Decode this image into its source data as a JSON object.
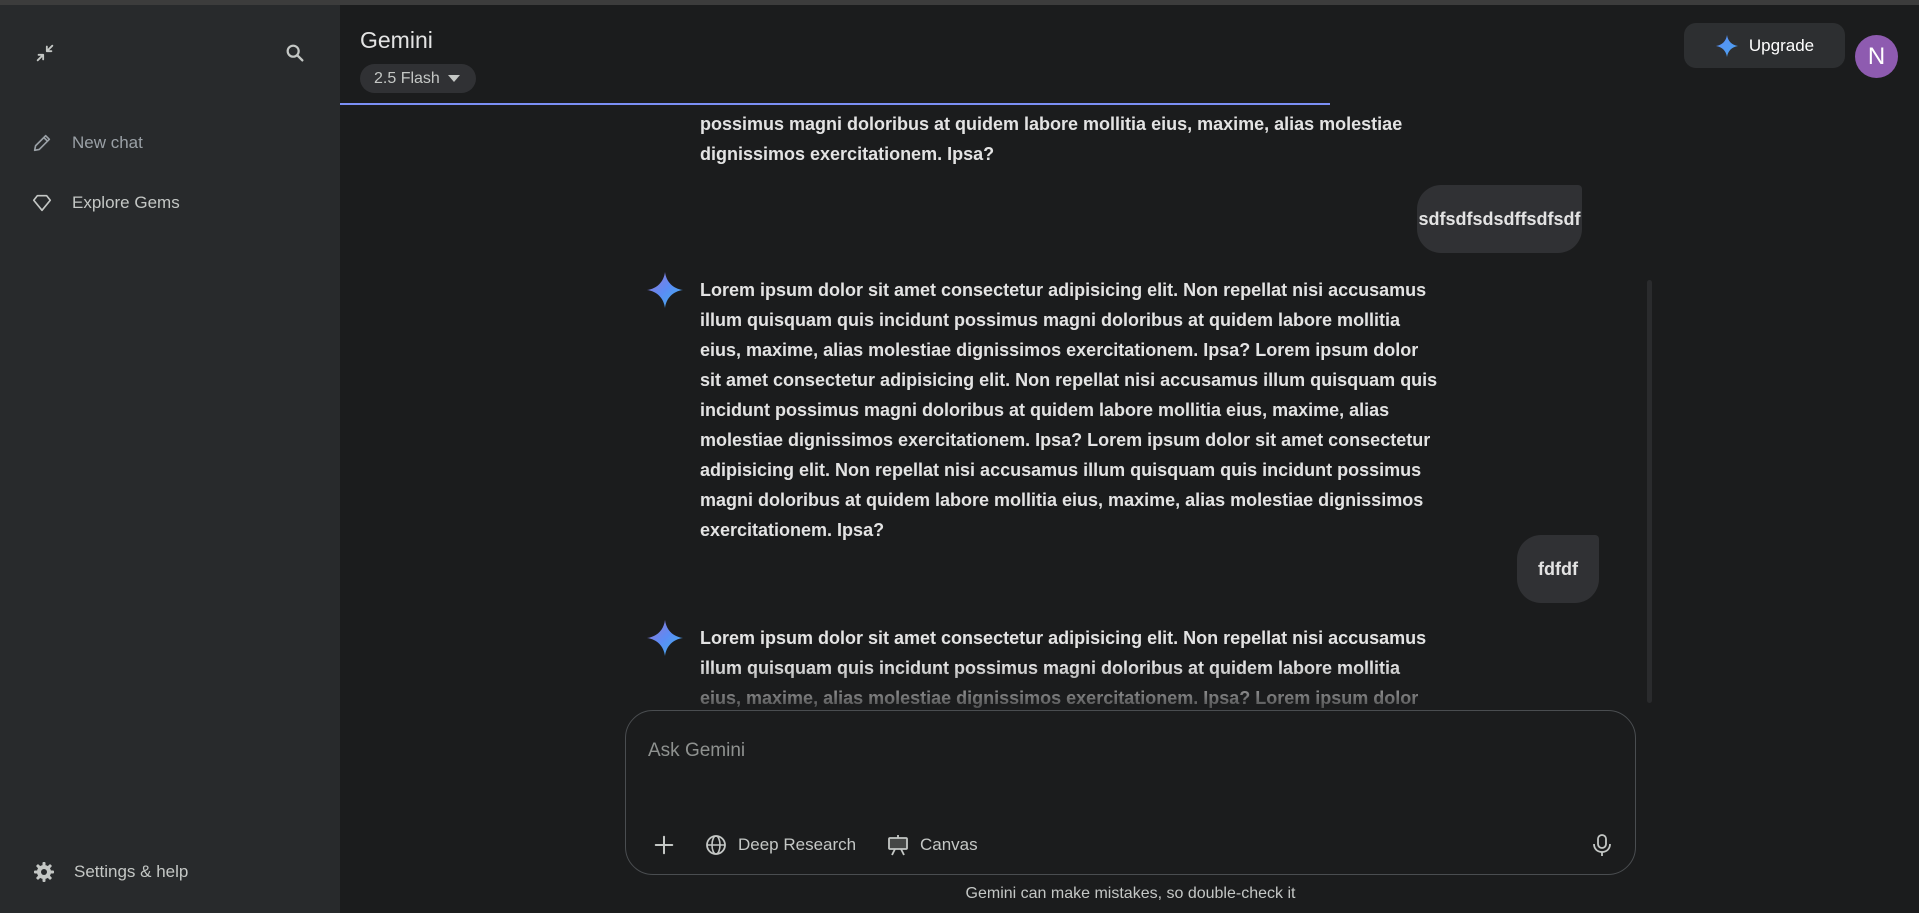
{
  "app": {
    "title": "Gemini",
    "model_label": "2.5 Flash",
    "upgrade_label": "Upgrade",
    "avatar_initial": "N"
  },
  "sidebar": {
    "items": [
      {
        "label": "New chat",
        "icon": "pencil-icon"
      },
      {
        "label": "Explore Gems",
        "icon": "gem-icon"
      }
    ],
    "settings_label": "Settings & help"
  },
  "conversation": {
    "partial_top": "possimus magni doloribus at quidem labore mollitia eius, maxime, alias molestiae dignissimos exercitationem. Ipsa?",
    "user_msg_1": "sdfsdfsdsdffsdfsdf",
    "bot_msg_1": "Lorem ipsum dolor sit amet consectetur adipisicing elit. Non repellat nisi accusamus illum quisquam quis incidunt possimus magni doloribus at quidem labore mollitia eius, maxime, alias molestiae dignissimos exercitationem. Ipsa? Lorem ipsum dolor sit amet consectetur adipisicing elit. Non repellat nisi accusamus illum quisquam quis incidunt possimus magni doloribus at quidem labore mollitia eius, maxime, alias molestiae dignissimos exercitationem. Ipsa? Lorem ipsum dolor sit amet consectetur adipisicing elit. Non repellat nisi accusamus illum quisquam quis incidunt possimus magni doloribus at quidem labore mollitia eius, maxime, alias molestiae dignissimos exercitationem. Ipsa?",
    "user_msg_2": "fdfdf",
    "bot_msg_2": "Lorem ipsum dolor sit amet consectetur adipisicing elit. Non repellat nisi accusamus illum quisquam quis incidunt possimus magni doloribus at quidem labore mollitia eius, maxime, alias molestiae dignissimos exercitationem. Ipsa? Lorem ipsum dolor sit amet consectetur adipisicing"
  },
  "composer": {
    "placeholder": "Ask Gemini",
    "deep_research_label": "Deep Research",
    "canvas_label": "Canvas"
  },
  "footer": {
    "disclaimer": "Gemini can make mistakes, so double-check it"
  },
  "colors": {
    "background": "#1b1c1d",
    "sidebar": "#282a2c",
    "accent": "#7b8ff5",
    "avatar": "#8e5bb0"
  }
}
